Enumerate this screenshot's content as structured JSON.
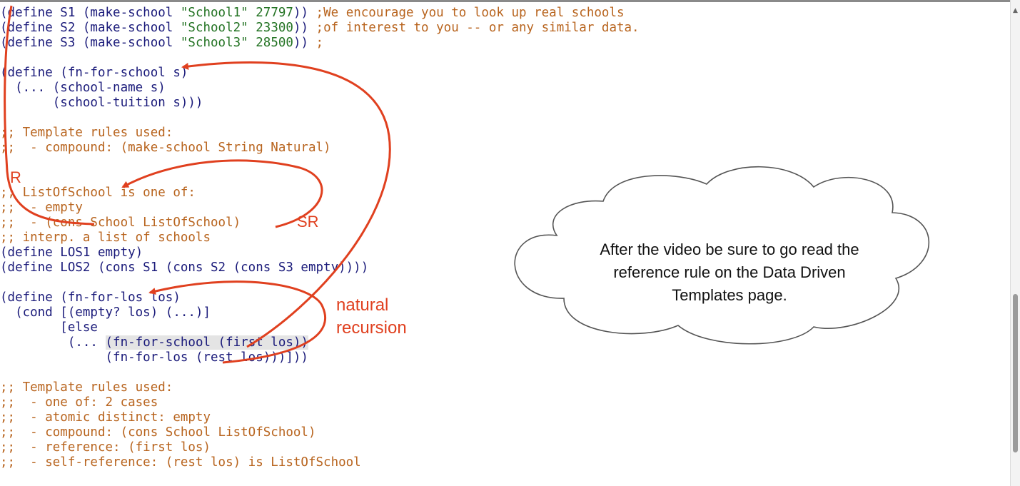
{
  "code_lines": [
    {
      "segs": [
        {
          "t": "(define S1 (make-school ",
          "k": "p"
        },
        {
          "t": "\"School1\"",
          "k": "s"
        },
        {
          "t": " ",
          "k": "p"
        },
        {
          "t": "27797",
          "k": "n"
        },
        {
          "t": ")) ",
          "k": "p"
        },
        {
          "t": ";We encourage you to look up real schools",
          "k": "c"
        }
      ]
    },
    {
      "segs": [
        {
          "t": "(define S2 (make-school ",
          "k": "p"
        },
        {
          "t": "\"School2\"",
          "k": "s"
        },
        {
          "t": " ",
          "k": "p"
        },
        {
          "t": "23300",
          "k": "n"
        },
        {
          "t": ")) ",
          "k": "p"
        },
        {
          "t": ";of interest to you -- or any similar data.",
          "k": "c"
        }
      ]
    },
    {
      "segs": [
        {
          "t": "(define S3 (make-school ",
          "k": "p"
        },
        {
          "t": "\"School3\"",
          "k": "s"
        },
        {
          "t": " ",
          "k": "p"
        },
        {
          "t": "28500",
          "k": "n"
        },
        {
          "t": ")) ",
          "k": "p"
        },
        {
          "t": ";",
          "k": "c"
        }
      ]
    },
    {
      "segs": []
    },
    {
      "segs": [
        {
          "t": "(define (fn-for-school s)",
          "k": "p"
        }
      ]
    },
    {
      "segs": [
        {
          "t": "  (... (school-name s)",
          "k": "p"
        }
      ]
    },
    {
      "segs": [
        {
          "t": "       (school-tuition s)))",
          "k": "p"
        }
      ]
    },
    {
      "segs": []
    },
    {
      "segs": [
        {
          "t": ";; Template rules used:",
          "k": "c"
        }
      ]
    },
    {
      "segs": [
        {
          "t": ";;  - compound: (make-school String Natural)",
          "k": "c"
        }
      ]
    },
    {
      "segs": []
    },
    {
      "segs": []
    },
    {
      "segs": [
        {
          "t": ";; ListOfSchool is one of:",
          "k": "c"
        }
      ]
    },
    {
      "segs": [
        {
          "t": ";;  - empty",
          "k": "c"
        }
      ]
    },
    {
      "segs": [
        {
          "t": ";;  - (cons School ListOfSchool)",
          "k": "c"
        }
      ]
    },
    {
      "segs": [
        {
          "t": ";; interp. a list of schools",
          "k": "c"
        }
      ]
    },
    {
      "segs": [
        {
          "t": "(define LOS1 empty)",
          "k": "p"
        }
      ]
    },
    {
      "segs": [
        {
          "t": "(define LOS2 (cons S1 (cons S2 (cons S3 empty))))",
          "k": "p"
        }
      ]
    },
    {
      "segs": []
    },
    {
      "segs": [
        {
          "t": "(define (fn-for-los los)",
          "k": "p"
        }
      ]
    },
    {
      "segs": [
        {
          "t": "  (cond [(empty? los) (...)]",
          "k": "p"
        }
      ]
    },
    {
      "segs": [
        {
          "t": "        [else",
          "k": "p"
        }
      ]
    },
    {
      "segs": [
        {
          "t": "         (... ",
          "k": "p"
        },
        {
          "t": "(fn-for-school (first los))",
          "k": "hl"
        }
      ]
    },
    {
      "segs": [
        {
          "t": "              (fn-for-los (rest los)))]))",
          "k": "p"
        }
      ]
    },
    {
      "segs": []
    },
    {
      "segs": [
        {
          "t": ";; Template rules used:",
          "k": "c"
        }
      ]
    },
    {
      "segs": [
        {
          "t": ";;  - one of: 2 cases",
          "k": "c"
        }
      ]
    },
    {
      "segs": [
        {
          "t": ";;  - atomic distinct: empty",
          "k": "c"
        }
      ]
    },
    {
      "segs": [
        {
          "t": ";;  - compound: (cons School ListOfSchool)",
          "k": "c"
        }
      ]
    },
    {
      "segs": [
        {
          "t": ";;  - reference: (first los)",
          "k": "c"
        }
      ]
    },
    {
      "segs": [
        {
          "t": ";;  - self-reference: (rest los) is ListOfSchool",
          "k": "c"
        }
      ]
    }
  ],
  "annotations": {
    "r": "R",
    "sr": "SR",
    "natural_line1": "natural",
    "natural_line2": "recursion"
  },
  "callout": {
    "text": "After the video be sure to go read the reference rule on the Data Driven Templates page."
  },
  "colors": {
    "paren_code": "#1a1a7a",
    "comment": "#b8641e",
    "string_literal": "#237323",
    "annotation_ink": "#e0401f",
    "highlight_bg": "#e4e4e4"
  },
  "icons": {
    "scroll_up": "▲"
  }
}
